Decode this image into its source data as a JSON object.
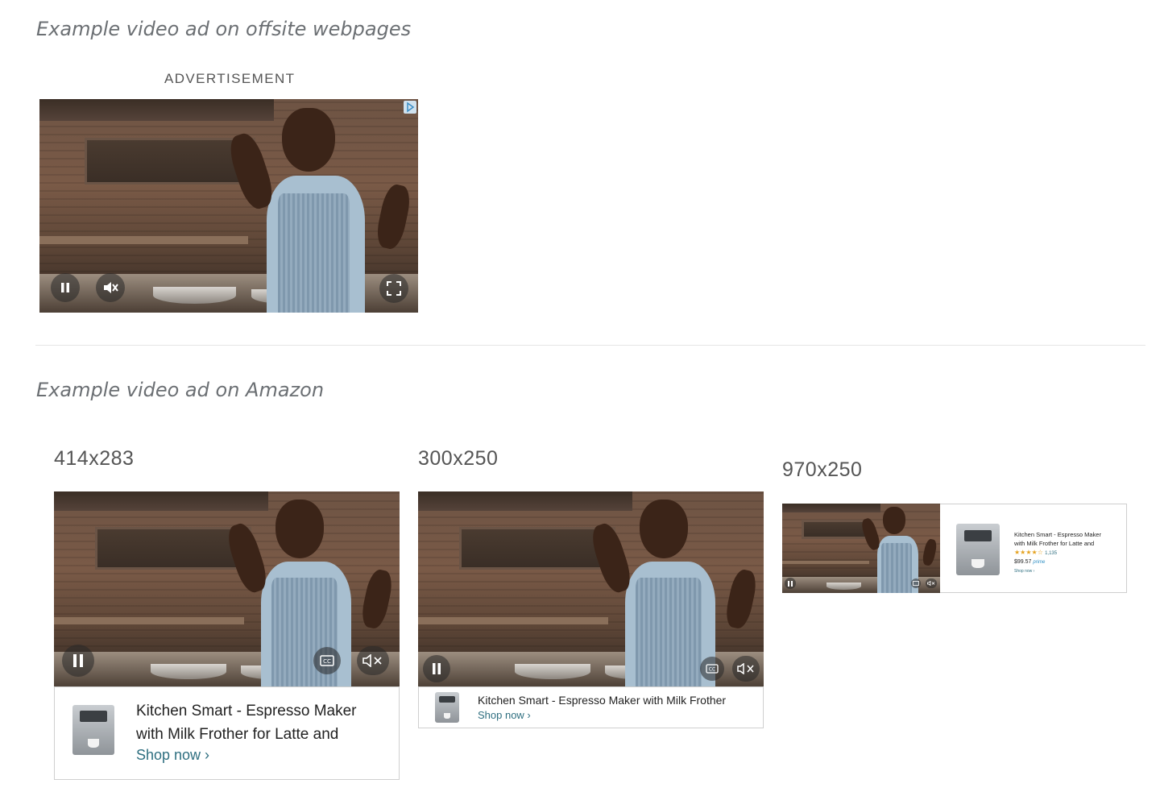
{
  "offsite": {
    "title": "Example video ad on offsite webpages",
    "ad_label": "ADVERTISEMENT"
  },
  "amazon": {
    "title": "Example video ad on Amazon",
    "sizes": [
      {
        "label": "414x283"
      },
      {
        "label": "300x250"
      },
      {
        "label": "970x250"
      }
    ]
  },
  "product": {
    "title_line1": "Kitchen Smart - Espresso Maker",
    "title_line2": "with Milk Frother for Latte and",
    "title_full": "Kitchen Smart - Espresso Maker with Milk Frother",
    "small_line1": "Kitchen Smart - Espresso Maker",
    "small_line2": "with Milk Frother for Latte and",
    "stars": "★★★★☆",
    "rating_count": "1,135",
    "price": "$99.57",
    "prime": "prime",
    "shop_now": "Shop now ›",
    "shop_now_small": "Shop now ›"
  },
  "icons": {
    "pause": "pause-icon",
    "mute": "mute-icon",
    "fullscreen": "fullscreen-icon",
    "cc": "closed-captions-icon",
    "adchoices": "adchoices-icon"
  },
  "colors": {
    "section_title": "#6b6f73",
    "shop_link": "#2f6f80",
    "divider": "#e5e5e5"
  }
}
